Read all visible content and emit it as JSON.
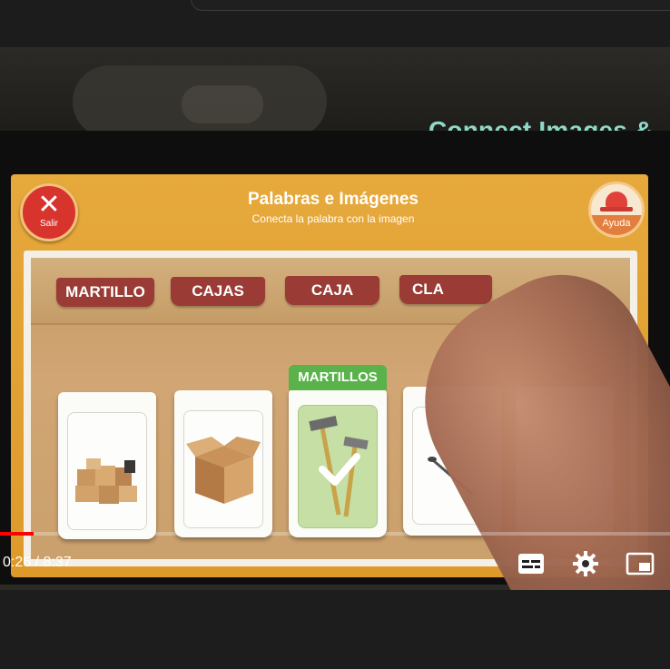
{
  "video": {
    "title_overlay": "Connect Images &",
    "time_current": "0:26",
    "time_separator": "/",
    "time_total": "8:37",
    "progress_fraction": 0.0503
  },
  "app": {
    "title": "Palabras e Imágenes",
    "subtitle": "Conecta la palabra con la imagen",
    "exit_label": "Salir",
    "help_label": "Ayuda",
    "words": [
      "MARTILLO",
      "CAJAS",
      "CAJA",
      "CLA"
    ],
    "cards": [
      {
        "icon": "stacked-boxes-icon"
      },
      {
        "icon": "open-box-icon"
      },
      {
        "icon": "hammers-icon",
        "tag": "MARTILLOS",
        "selected": true
      },
      {
        "icon": "nail-icon"
      },
      {
        "icon": "card-partial"
      }
    ]
  },
  "controls": {
    "icons": [
      "subtitles-icon",
      "settings-gear-icon",
      "miniplayer-icon"
    ]
  },
  "colors": {
    "app_orange": "#e6a93c",
    "word_tag": "#9a3b35",
    "selected_green": "#59b24a",
    "exit_red": "#d8342e",
    "title_teal": "#8fd9c8",
    "progress_red": "#ff0000"
  }
}
